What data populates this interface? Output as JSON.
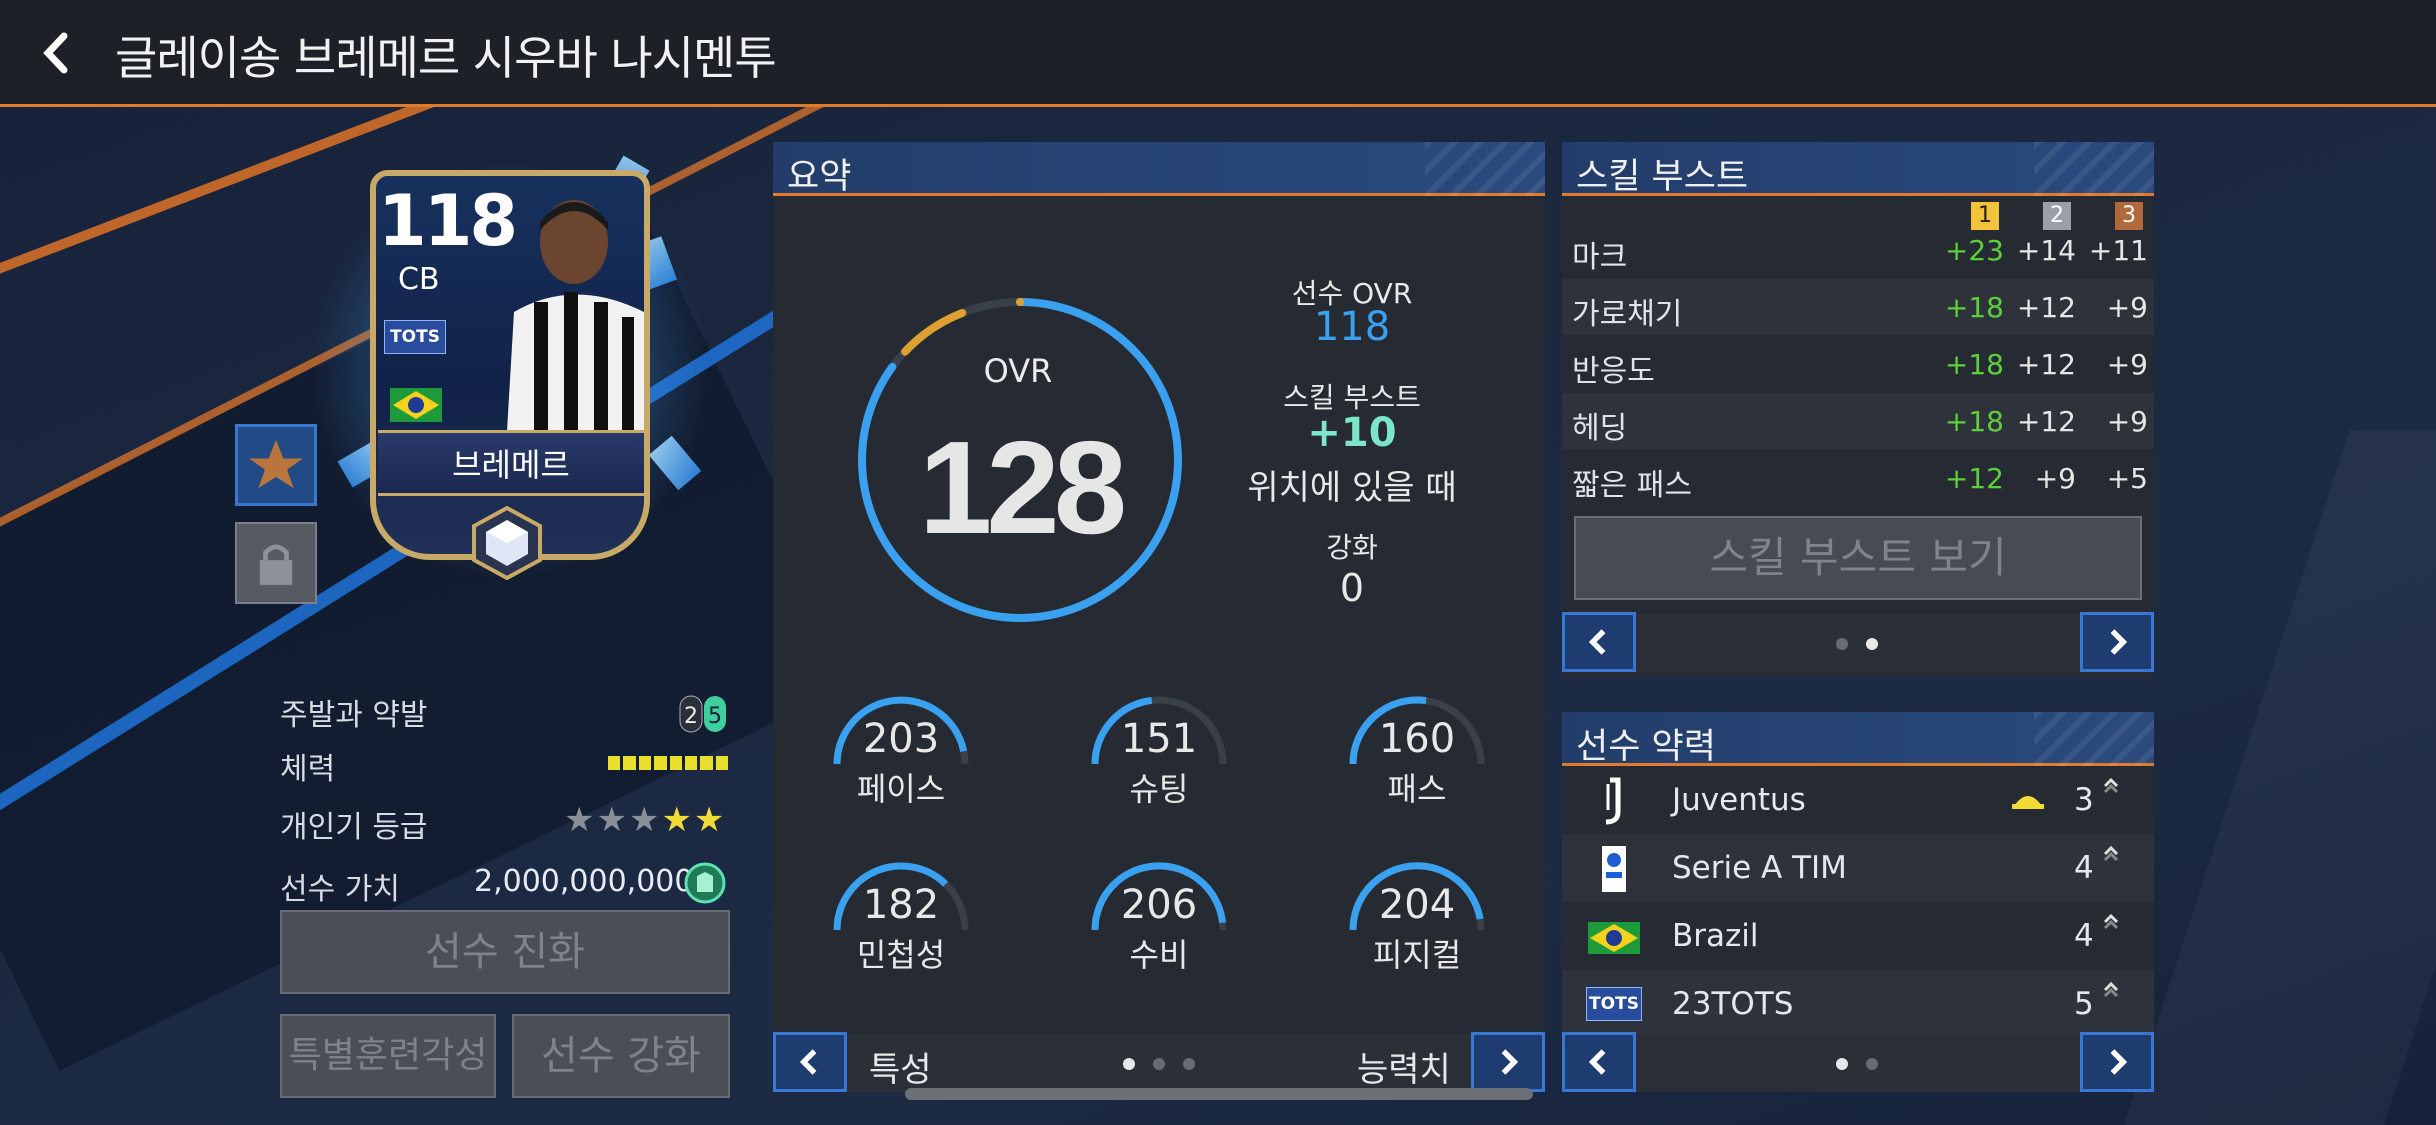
{
  "header": {
    "title": "글레이송 브레메르 시우바 나시멘투"
  },
  "card": {
    "ovr": "118",
    "position": "CB",
    "badge": "TOTS",
    "name": "브레메르"
  },
  "info": {
    "foot_label": "주발과 약발",
    "foot_weak": "2",
    "foot_strong": "5",
    "stamina_label": "체력",
    "popularity_label": "개인기 등급",
    "popularity_stars": 2,
    "popularity_max": 5,
    "value_label": "선수 가치",
    "value": "2,000,000,000"
  },
  "buttons": {
    "evolve": "선수 진화",
    "special_training": "특별훈련각성",
    "enhance": "선수 강화"
  },
  "summary": {
    "title": "요약",
    "ovr_label": "OVR",
    "ovr": "128",
    "ring_fraction": 0.85,
    "player_ovr_label": "선수 OVR",
    "player_ovr": "118",
    "boost_label": "스킬 부스트",
    "boost_value": "+10",
    "boost_note": "위치에 있을 때",
    "enhance_label": "강화",
    "enhance_value": "0",
    "stats": [
      {
        "value": "203",
        "label": "페이스"
      },
      {
        "value": "151",
        "label": "슈팅"
      },
      {
        "value": "160",
        "label": "패스"
      },
      {
        "value": "182",
        "label": "민첩성"
      },
      {
        "value": "206",
        "label": "수비"
      },
      {
        "value": "204",
        "label": "피지컬"
      }
    ],
    "nav_left_label": "특성",
    "nav_right_label": "능력치"
  },
  "skill_boost": {
    "title": "스킬 부스트",
    "ranks": [
      "1",
      "2",
      "3"
    ],
    "rows": [
      {
        "name": "마크",
        "v1": "+23",
        "v2": "+14",
        "v3": "+11"
      },
      {
        "name": "가로채기",
        "v1": "+18",
        "v2": "+12",
        "v3": "+9"
      },
      {
        "name": "반응도",
        "v1": "+18",
        "v2": "+12",
        "v3": "+9"
      },
      {
        "name": "헤딩",
        "v1": "+18",
        "v2": "+12",
        "v3": "+9"
      },
      {
        "name": "짧은 패스",
        "v1": "+12",
        "v2": "+9",
        "v3": "+5"
      }
    ],
    "view_button": "스킬 부스트 보기"
  },
  "chemistry": {
    "title": "선수 약력",
    "rows": [
      {
        "name": "Juventus",
        "count": "3",
        "icon": "juventus-logo"
      },
      {
        "name": "Serie A TIM",
        "count": "4",
        "icon": "serie-a-logo"
      },
      {
        "name": "Brazil",
        "count": "4",
        "icon": "brazil-flag"
      },
      {
        "name": "23TOTS",
        "count": "5",
        "icon": "tots-badge",
        "badge": "TOTS"
      }
    ]
  },
  "colors": {
    "accent": "#e07b2e",
    "green": "#5ecf3b",
    "blue": "#3aa0f0",
    "cyan": "#7ee6c8"
  }
}
